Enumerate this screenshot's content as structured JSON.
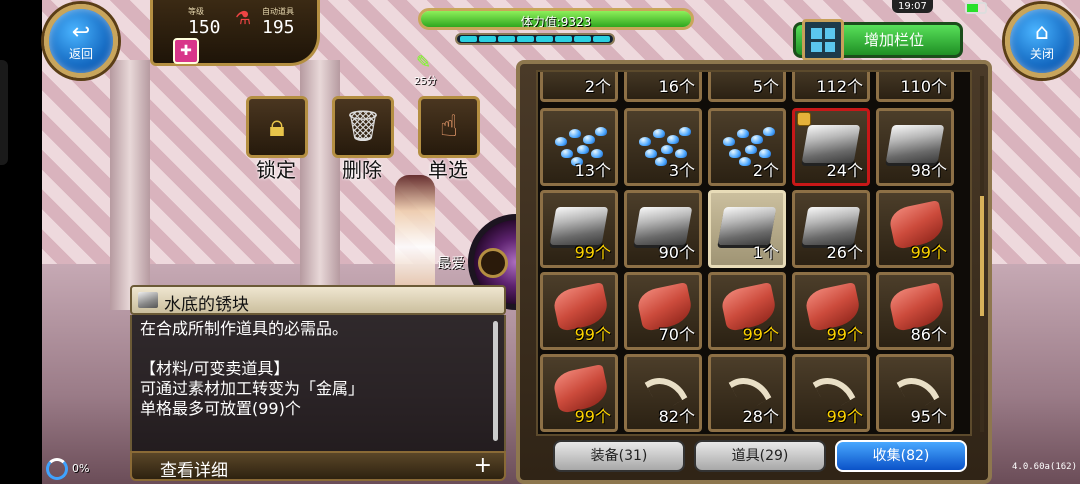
{
  "top_left": {
    "back_label": "返回",
    "level_label": "等级",
    "level_value": "150",
    "auto_item_label": "自动道具",
    "auto_item_value": "195"
  },
  "stamina": {
    "text": "体力值:9323",
    "timer_text": "25分"
  },
  "top_right": {
    "clock": "19:07",
    "add_slot_label": "增加栏位",
    "close_label": "关闭"
  },
  "actions": {
    "lock": "锁定",
    "delete": "删除",
    "single_select": "单选",
    "favorite": "最爱"
  },
  "detail": {
    "title": "水底的锈块",
    "lines": [
      "在合成所制作道具的必需品。",
      "",
      "【材料/可变卖道具】",
      "可通过素材加工转变为「金属」",
      "单格最多可放置(99)个"
    ],
    "view_more": "查看详细",
    "plus": "+"
  },
  "inventory": {
    "top_row": [
      "2个",
      "16个",
      "5个",
      "112个",
      "110个"
    ],
    "rows": [
      [
        {
          "icon": "blue-gem-icon",
          "qty": "13个",
          "max": false
        },
        {
          "icon": "blue-gem-icon",
          "qty": "3个",
          "max": false
        },
        {
          "icon": "blue-gem-icon",
          "qty": "2个",
          "max": false
        },
        {
          "icon": "iron-ingot-icon",
          "qty": "24个",
          "max": false,
          "locked": true
        },
        {
          "icon": "iron-ingot-icon",
          "qty": "98个",
          "max": false
        }
      ],
      [
        {
          "icon": "iron-ingot-icon",
          "qty": "99个",
          "max": true
        },
        {
          "icon": "iron-ingot-icon",
          "qty": "90个",
          "max": false
        },
        {
          "icon": "iron-ingot-icon",
          "qty": "1个",
          "max": false,
          "selected": true
        },
        {
          "icon": "iron-ingot-icon",
          "qty": "26个",
          "max": false
        },
        {
          "icon": "red-cloth-icon",
          "qty": "99个",
          "max": true
        }
      ],
      [
        {
          "icon": "red-cloth-icon",
          "qty": "99个",
          "max": true
        },
        {
          "icon": "red-cloth-icon",
          "qty": "70个",
          "max": false
        },
        {
          "icon": "red-cloth-icon",
          "qty": "99个",
          "max": true
        },
        {
          "icon": "red-cloth-icon",
          "qty": "99个",
          "max": true
        },
        {
          "icon": "red-cloth-icon",
          "qty": "86个",
          "max": false
        }
      ],
      [
        {
          "icon": "red-cloth-icon",
          "qty": "99个",
          "max": true
        },
        {
          "icon": "claw-icon",
          "qty": "82个",
          "max": false
        },
        {
          "icon": "claw-icon",
          "qty": "28个",
          "max": false
        },
        {
          "icon": "claw-icon",
          "qty": "99个",
          "max": true
        },
        {
          "icon": "claw-icon",
          "qty": "95个",
          "max": false
        }
      ]
    ]
  },
  "tabs": [
    {
      "label": "装备(31)",
      "active": false
    },
    {
      "label": "道具(29)",
      "active": false
    },
    {
      "label": "收集(82)",
      "active": true
    }
  ],
  "footer": {
    "version": "4.0.60a(162)",
    "percent": "0%"
  },
  "colors": {
    "accent_blue": "#0b52c8",
    "gold_border": "#b48f42",
    "max_qty": "#ffd400",
    "stamina_green": "#2fa71f"
  },
  "stamina_fill_fraction": 1.0
}
